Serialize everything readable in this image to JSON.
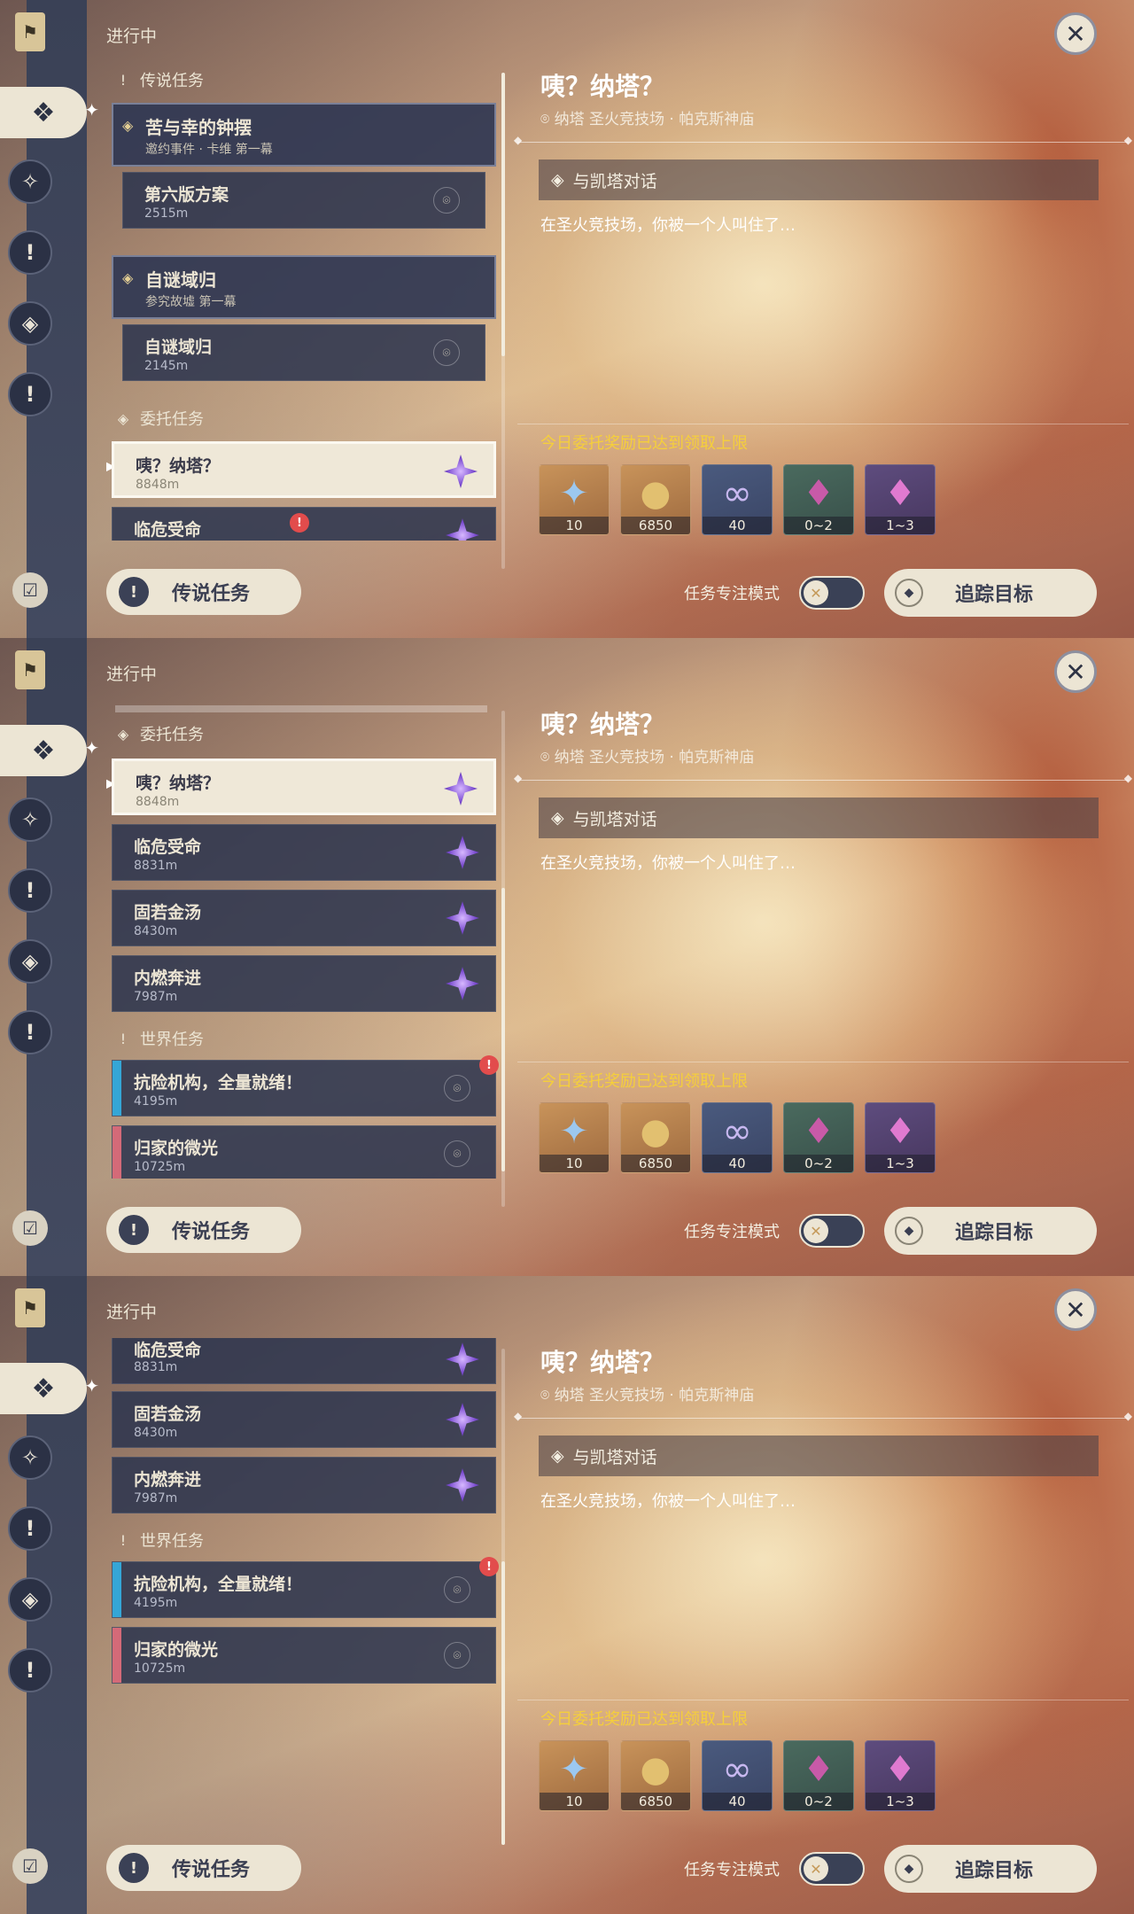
{
  "status_title": "进行中",
  "icons": {
    "bookmark": "bookmark-icon",
    "archon": "four-diamond-icon",
    "legend": "exclamation-icon",
    "commission": "diamond-icon",
    "world": "exclamation-icon",
    "close": "close-icon"
  },
  "sections": {
    "legend": "传说任务",
    "commission": "委托任务",
    "world": "世界任务"
  },
  "legend_quests": [
    {
      "title": "苦与幸的钟摆",
      "subtitle": "邀约事件 · 卡维 第一幕",
      "step": "第六版方案",
      "distance": "2515m"
    },
    {
      "title": "自谜域归",
      "subtitle": "参究故墟 第一幕",
      "step": "自谜域归",
      "distance": "2145m"
    }
  ],
  "commission_quests": [
    {
      "title": "咦？纳塔？",
      "distance": "8848m"
    },
    {
      "title": "临危受命",
      "distance": "8831m"
    },
    {
      "title": "固若金汤",
      "distance": "8430m"
    },
    {
      "title": "内燃奔进",
      "distance": "7987m"
    }
  ],
  "world_quests": [
    {
      "title": "抗险机构，全量就绪！",
      "distance": "4195m",
      "accent": "#35a6d6",
      "alert": "!"
    },
    {
      "title": "归家的微光",
      "distance": "10725m",
      "accent": "#d46a78"
    }
  ],
  "legend_button": "传说任务",
  "detail": {
    "title": "咦？纳塔？",
    "location": "纳塔 圣火竞技场 · 帕克斯神庙",
    "objective": "与凯塔对话",
    "description": "在圣火竞技场，你被一个人叫住了…",
    "reward_note": "今日委托奖励已达到领取上限",
    "rewards": [
      {
        "qty": "10",
        "icon": "primogem-icon",
        "tone": "gold",
        "glyph": "✦",
        "color": "#9cc8f0"
      },
      {
        "qty": "6850",
        "icon": "mora-icon",
        "tone": "gold",
        "glyph": "●",
        "color": "#d9b45a"
      },
      {
        "qty": "40",
        "icon": "companionship-icon",
        "tone": "blue",
        "glyph": "∞",
        "color": "#c8b8f0"
      },
      {
        "qty": "0~2",
        "icon": "ore-icon",
        "tone": "green",
        "glyph": "♦",
        "color": "#c85aa8"
      },
      {
        "qty": "1~3",
        "icon": "crystal-icon",
        "tone": "purple",
        "glyph": "♦",
        "color": "#d46ac8"
      }
    ],
    "focus_label": "任务专注模式",
    "track_button": "追踪目标"
  }
}
